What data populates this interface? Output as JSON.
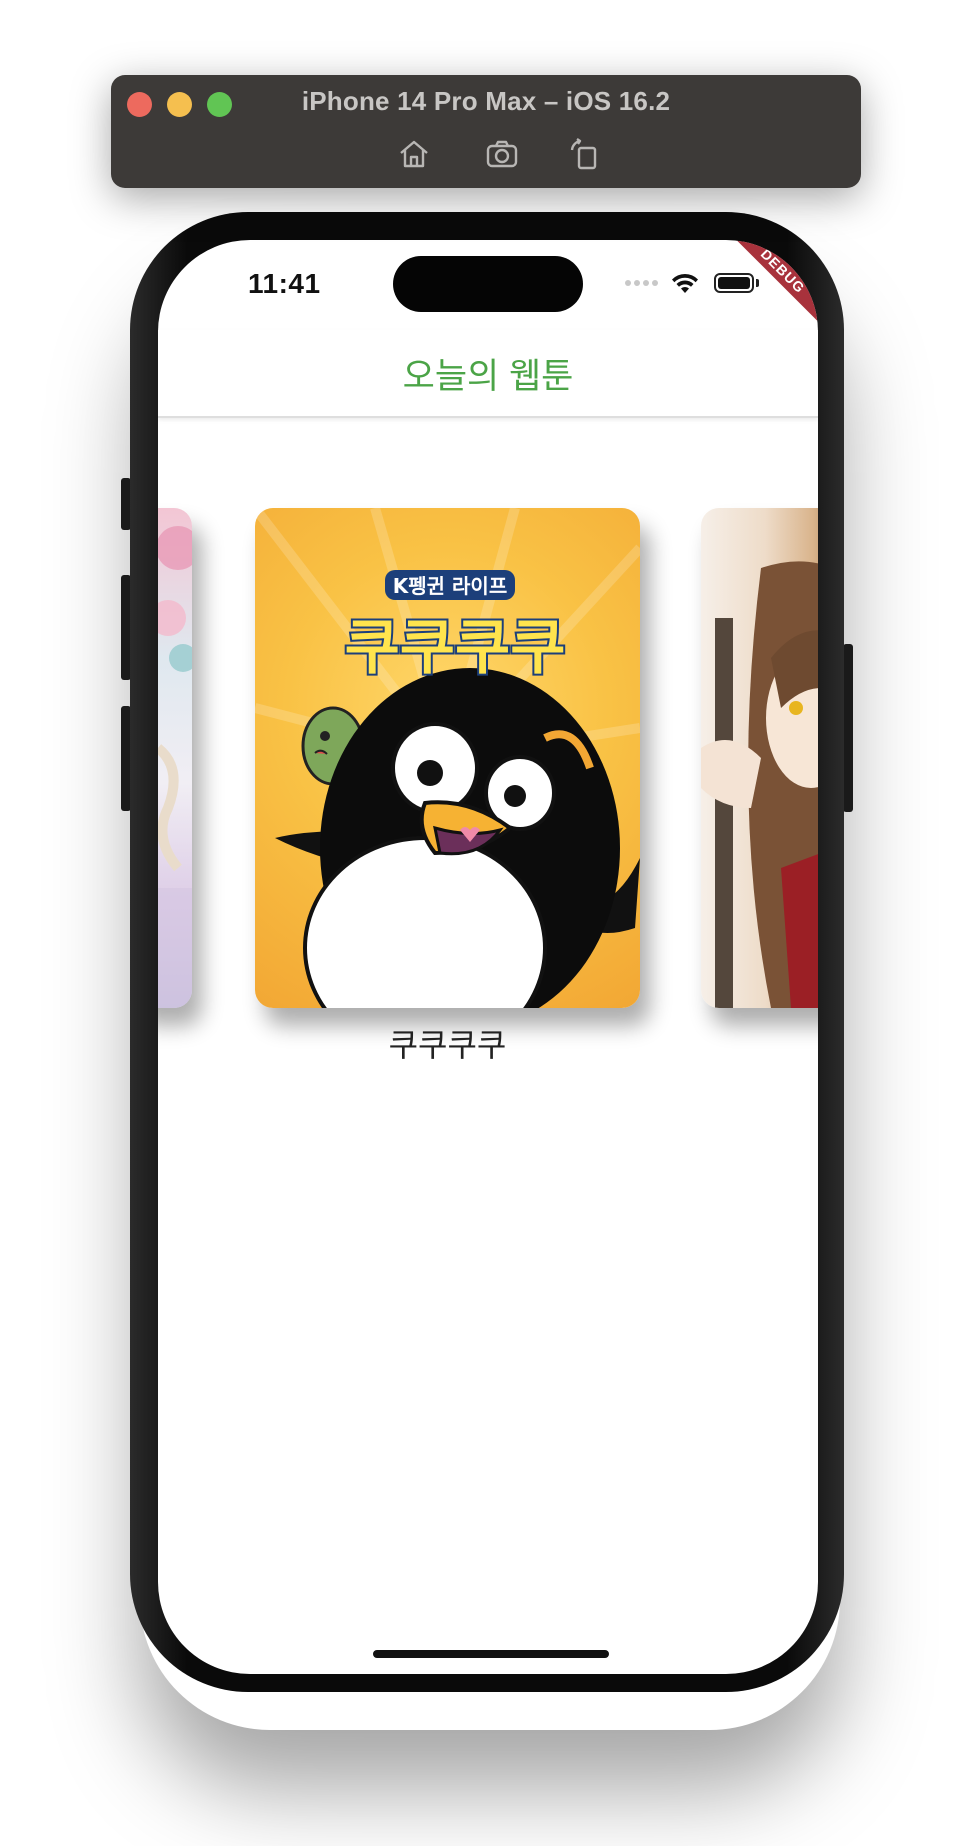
{
  "simulator": {
    "title": "iPhone 14 Pro Max – iOS 16.2",
    "toolbar": [
      {
        "name": "home-icon"
      },
      {
        "name": "screenshot-icon"
      },
      {
        "name": "rotate-icon"
      }
    ]
  },
  "status_bar": {
    "time": "11:41",
    "debug_label": "DEBUG"
  },
  "app": {
    "title": "오늘의 웹툰",
    "title_color": "#4ba447",
    "webtoons": [
      {
        "title": "",
        "position": "previous"
      },
      {
        "title": "쿠쿠쿠쿠",
        "position": "current",
        "cover_text_top": "K펭귄 라이프",
        "cover_text_main": "쿠쿠쿠쿠"
      },
      {
        "title": "",
        "position": "next"
      }
    ]
  }
}
